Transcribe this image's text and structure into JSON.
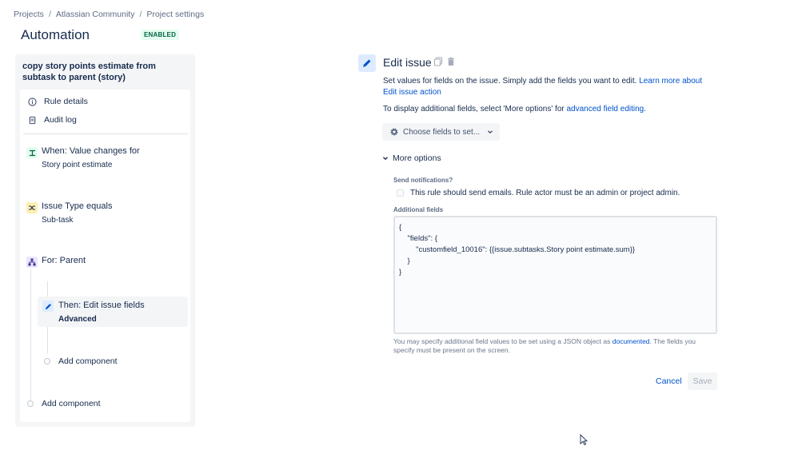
{
  "breadcrumb": [
    "Projects",
    "Atlassian Community",
    "Project settings"
  ],
  "page_title": "Automation",
  "status_badge": "ENABLED",
  "rule": {
    "title": "copy story points estimate from subtask to parent (story)",
    "menu": [
      "Rule details",
      "Audit log"
    ],
    "steps": {
      "trigger_title": "When: Value changes for",
      "trigger_sub": "Story point estimate",
      "condition_title": "Issue Type equals",
      "condition_sub": "Sub-task",
      "branch_title": "For: Parent",
      "action_title": "Then: Edit issue fields",
      "action_sub": "Advanced",
      "add_inner": "Add component",
      "add_outer": "Add component"
    }
  },
  "editor": {
    "title": "Edit issue",
    "description": "Set values for fields on the issue. Simply add the fields you want to edit.",
    "learn_more_link": "Learn more about Edit issue action",
    "more_fields_text": "To display additional fields, select 'More options' for",
    "advanced_link": "advanced field editing.",
    "choose_fields": "Choose fields to set...",
    "more_options": "More options",
    "send_notifications_label": "Send notifications?",
    "send_notifications_text": "This rule should send emails. Rule actor must be an admin or project admin.",
    "additional_fields_label": "Additional fields",
    "additional_fields_value": "{\n    \"fields\": {\n        \"customfield_10016\": {{issue.subtasks.Story point estimate.sum}}\n    }\n}",
    "help_prefix": "You may specify additional field values to be set using a JSON object as",
    "help_link": "documented",
    "help_suffix": ". The fields you specify must be present on the screen.",
    "cancel": "Cancel",
    "save": "Save"
  },
  "colors": {
    "link": "#0052cc",
    "badge_bg": "#e3fcef",
    "badge_text": "#006644",
    "trigger_icon_bg": "#e3fcef",
    "condition_icon_bg": "#fff0b3",
    "branch_icon_bg": "#eae6ff",
    "action_icon_bg": "#deebff"
  }
}
